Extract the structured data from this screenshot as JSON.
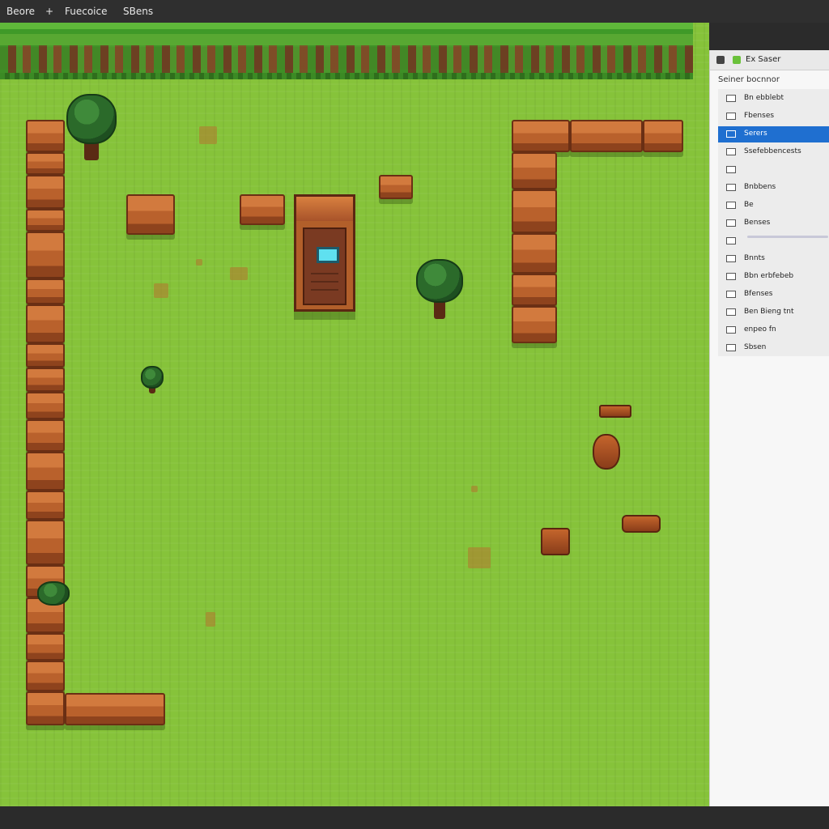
{
  "menubar": {
    "items": [
      "Beore",
      "+",
      "Fuecoice",
      "SBens"
    ]
  },
  "panel": {
    "title": "Ex Saser",
    "subtitle": "Seiner bocnnor",
    "items": [
      {
        "label": "Bn ebblebt",
        "icon": "layer-icon"
      },
      {
        "label": "Fbenses",
        "icon": "layer-icon"
      },
      {
        "label": "Serers",
        "icon": "layer-icon",
        "selected": true
      },
      {
        "label": "Ssefebbencests",
        "icon": "layer-icon"
      },
      {
        "label": "",
        "icon": "layer-icon"
      },
      {
        "label": "Bnbbens",
        "icon": "layer-icon"
      },
      {
        "label": "Be",
        "icon": "layer-icon"
      },
      {
        "label": "Benses",
        "icon": "layer-icon"
      },
      {
        "label": "",
        "icon": "slider-icon"
      },
      {
        "label": "Bnnts",
        "icon": "layer-icon"
      },
      {
        "label": "Bbn erbfebeb",
        "icon": "layer-icon"
      },
      {
        "label": "Bfenses",
        "icon": "layer-icon"
      },
      {
        "label": "Ben Bieng tnt",
        "icon": "layer-icon"
      },
      {
        "label": "enpeo fn",
        "icon": "layer-icon"
      },
      {
        "label": "Sbsen",
        "icon": "layer-icon"
      }
    ]
  },
  "colors": {
    "grass": "#86c33a",
    "brick": "#c06a30",
    "selection": "#1f6fd0"
  }
}
